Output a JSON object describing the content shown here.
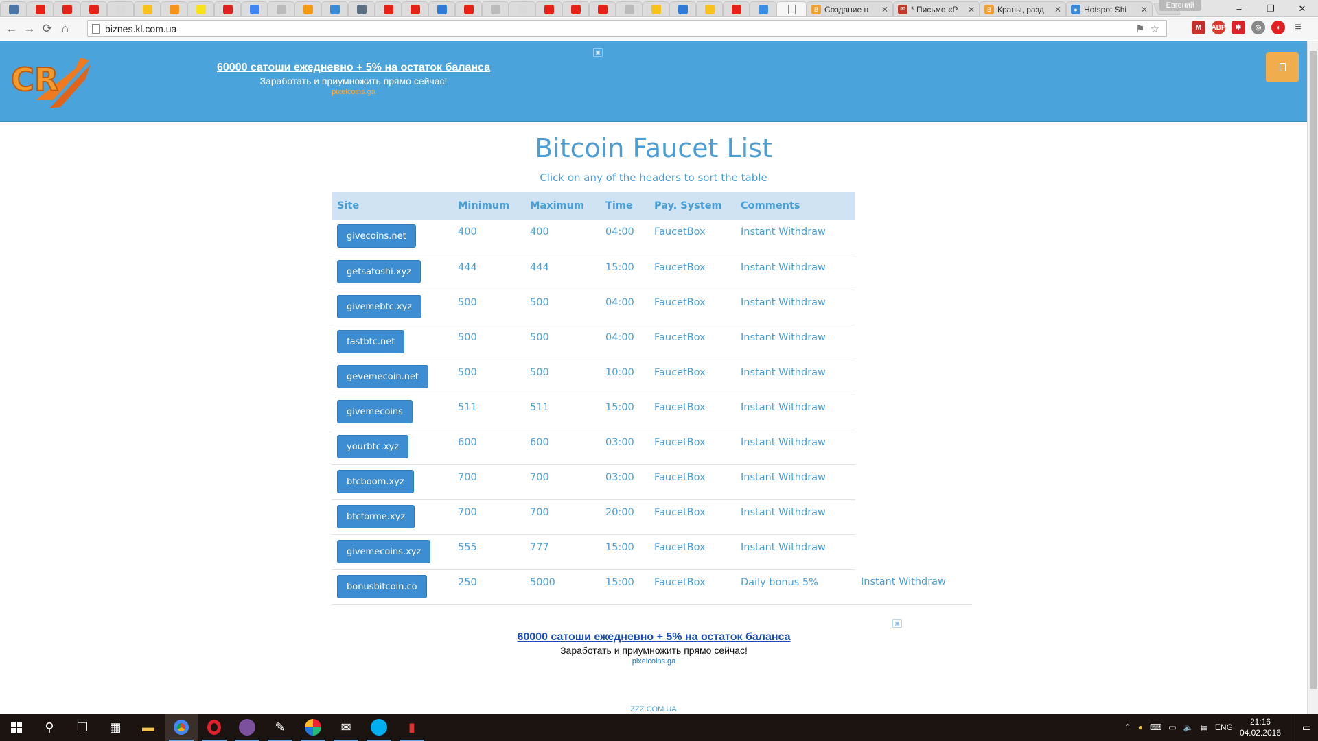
{
  "browser": {
    "profile_name": "Евгений",
    "url": "biznes.kl.com.ua",
    "text_tabs": [
      {
        "title": "Создание н",
        "color": "#f0a030",
        "glyph": "B"
      },
      {
        "title": "* Письмо «Р",
        "color": "#c0392b",
        "glyph": "✉"
      },
      {
        "title": "Краны, разд",
        "color": "#f0a030",
        "glyph": "B"
      },
      {
        "title": "Hotspot Shi",
        "color": "#3b8ad8",
        "glyph": "●"
      }
    ],
    "window_controls": {
      "minimize": "–",
      "maximize": "❐",
      "close": "✕"
    }
  },
  "header": {
    "logo_text": "CR",
    "ad": {
      "headline": "60000 сатоши ежедневно + 5% на остаток баланса",
      "subline": "Заработать и приумножить прямо сейчас!",
      "source": "pixelcoins.ga"
    }
  },
  "page": {
    "title": "Bitcoin Faucet List",
    "subtitle": "Click on any of the headers to sort the table",
    "columns": [
      "Site",
      "Minimum",
      "Maximum",
      "Time",
      "Pay. System",
      "Comments"
    ],
    "rows": [
      {
        "site": "givecoins.net",
        "min": "400",
        "max": "400",
        "time": "04:00",
        "pay": "FaucetBox",
        "comment": "Instant Withdraw",
        "extra": ""
      },
      {
        "site": "getsatoshi.xyz",
        "min": "444",
        "max": "444",
        "time": "15:00",
        "pay": "FaucetBox",
        "comment": "Instant Withdraw",
        "extra": ""
      },
      {
        "site": "givemebtc.xyz",
        "min": "500",
        "max": "500",
        "time": "04:00",
        "pay": "FaucetBox",
        "comment": "Instant Withdraw",
        "extra": ""
      },
      {
        "site": "fastbtc.net",
        "min": "500",
        "max": "500",
        "time": "04:00",
        "pay": "FaucetBox",
        "comment": "Instant Withdraw",
        "extra": ""
      },
      {
        "site": "gevemecoin.net",
        "min": "500",
        "max": "500",
        "time": "10:00",
        "pay": "FaucetBox",
        "comment": "Instant Withdraw",
        "extra": ""
      },
      {
        "site": "givemecoins",
        "min": "511",
        "max": "511",
        "time": "15:00",
        "pay": "FaucetBox",
        "comment": "Instant Withdraw",
        "extra": ""
      },
      {
        "site": "yourbtc.xyz",
        "min": "600",
        "max": "600",
        "time": "03:00",
        "pay": "FaucetBox",
        "comment": "Instant Withdraw",
        "extra": ""
      },
      {
        "site": "btcboom.xyz",
        "min": "700",
        "max": "700",
        "time": "03:00",
        "pay": "FaucetBox",
        "comment": "Instant Withdraw",
        "extra": ""
      },
      {
        "site": "btcforme.xyz",
        "min": "700",
        "max": "700",
        "time": "20:00",
        "pay": "FaucetBox",
        "comment": "Instant Withdraw",
        "extra": ""
      },
      {
        "site": "givemecoins.xyz",
        "min": "555",
        "max": "777",
        "time": "15:00",
        "pay": "FaucetBox",
        "comment": "Instant Withdraw",
        "extra": ""
      },
      {
        "site": "bonusbitcoin.co",
        "min": "250",
        "max": "5000",
        "time": "15:00",
        "pay": "FaucetBox",
        "comment": "Daily bonus 5%",
        "extra": "Instant Withdraw"
      }
    ]
  },
  "bottom_ad": {
    "headline": "60000 сатоши ежедневно + 5% на остаток баланса",
    "subline": "Заработать и приумножить прямо сейчас!",
    "source": "pixelcoins.ga"
  },
  "footer": {
    "link": "ZZZ.COM.UA"
  },
  "taskbar": {
    "language": "ENG",
    "time": "21:16",
    "date": "04.02.2016"
  },
  "colors": {
    "header_bg": "#4aa3db",
    "accent_text": "#4a9ed6",
    "site_button": "#3c8dd1",
    "menu_button": "#f0ad4e"
  }
}
